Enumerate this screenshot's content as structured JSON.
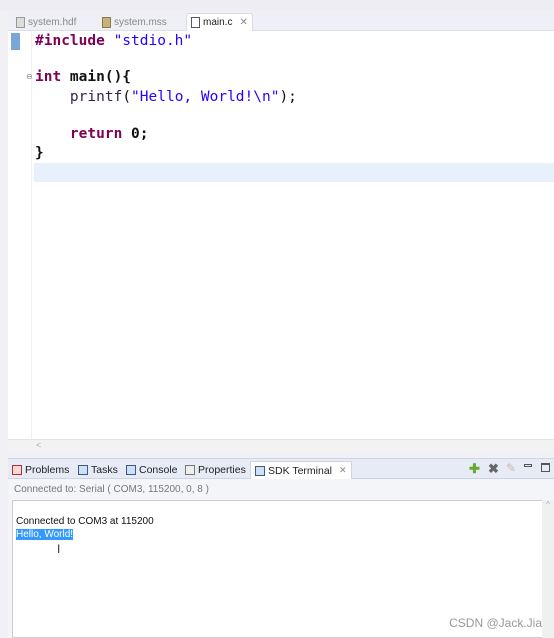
{
  "editor_tabs": [
    {
      "label": "system.hdf",
      "active": false
    },
    {
      "label": "system.mss",
      "active": false
    },
    {
      "label": "main.c",
      "active": true,
      "close": "✕"
    }
  ],
  "code": {
    "line1": {
      "kw": "#include",
      "str": " \"stdio.h\""
    },
    "line3": {
      "kw": "int",
      "rest": " main(){"
    },
    "line4": {
      "indent": "    ",
      "fn": "printf",
      "open": "(",
      "str": "\"Hello, World!\\n\"",
      "close": ");"
    },
    "line6": {
      "indent": "    ",
      "kw": "return",
      "rest": " 0;"
    },
    "line7": "}"
  },
  "panel_tabs": [
    {
      "label": "Problems"
    },
    {
      "label": "Tasks"
    },
    {
      "label": "Console"
    },
    {
      "label": "Properties"
    },
    {
      "label": "SDK Terminal",
      "active": true,
      "close": "✕"
    }
  ],
  "panel_icons": [
    "add-icon",
    "remove-icon",
    "clear-icon",
    "minimize-icon",
    "maximize-icon"
  ],
  "terminal": {
    "status": "Connected to: Serial (  COM3, 115200, 0, 8 )",
    "lines": [
      "Connected to COM3 at 115200",
      "Hello, World!"
    ]
  },
  "scroll_left": "<",
  "scroll_up": "^",
  "watermark": "CSDN @Jack.Jia"
}
